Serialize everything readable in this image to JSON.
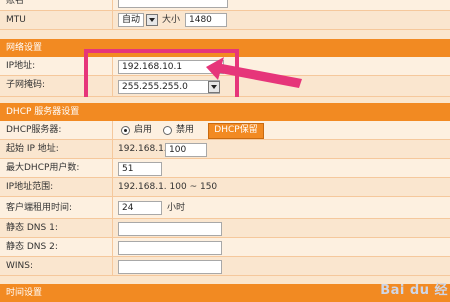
{
  "top": {
    "account_label": "账名",
    "mtu_label": "MTU",
    "mtu_mode": "自动",
    "mtu_size_label": "大小",
    "mtu_value": "1480"
  },
  "network": {
    "section_title": "网络设置",
    "ip_label": "IP地址:",
    "ip_value": "192.168.10.1",
    "mask_label": "子网掩码:",
    "mask_value": "255.255.255.0"
  },
  "dhcp": {
    "section_title": "DHCP 服务器设置",
    "server_label": "DHCP服务器:",
    "enable_label": "启用",
    "disable_label": "禁用",
    "reserve_button": "DHCP保留",
    "start_ip_label": "起始 IP 地址:",
    "start_ip_prefix": "192.168.1.",
    "start_ip_value": "100",
    "max_users_label": "最大DHCP用户数:",
    "max_users_value": "51",
    "range_label": "IP地址范围:",
    "range_value": "192.168.1. 100 ~ 150",
    "lease_label": "客户端租用时间:",
    "lease_value": "24",
    "lease_unit": "小时",
    "dns1_label": "静态 DNS 1:",
    "dns2_label": "静态 DNS 2:",
    "wins_label": "WINS:"
  },
  "time": {
    "section_title": "时间设置"
  },
  "watermark": "Bai du 经",
  "colors": {
    "accent": "#f28a22",
    "highlight": "#e6357a",
    "background": "#fbe6cd"
  }
}
